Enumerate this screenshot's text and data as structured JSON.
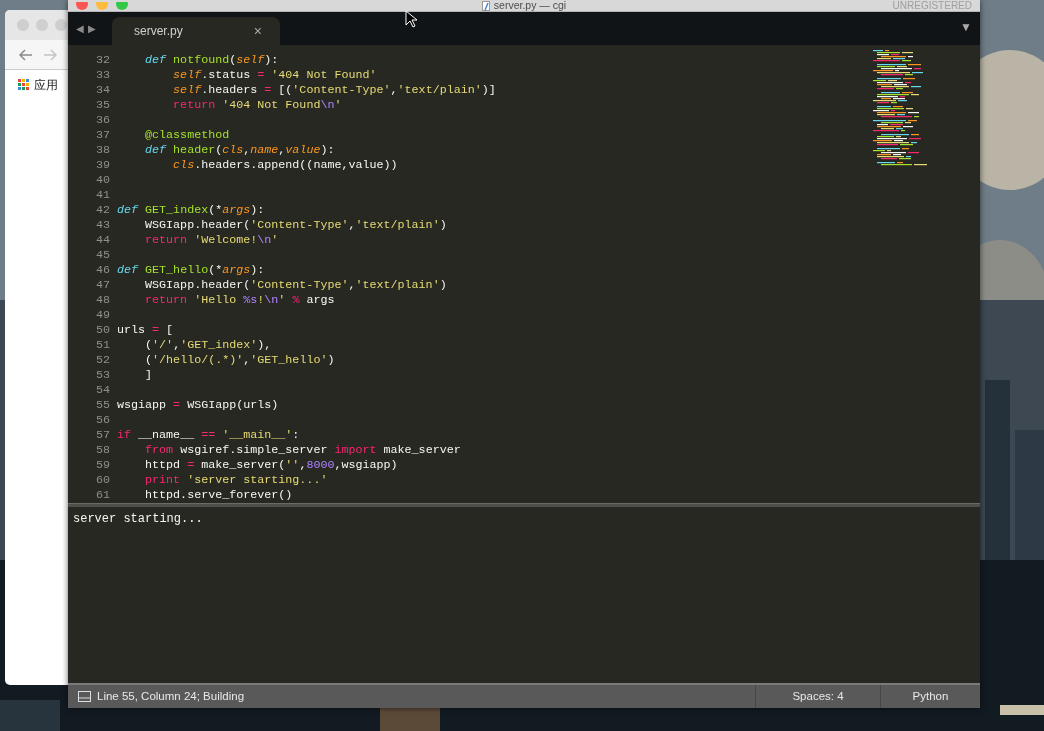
{
  "browser_window": {
    "bookmark_label": "应用"
  },
  "editor": {
    "title": "server.py — cgi",
    "license": "UNREGISTERED",
    "tab_nav": [
      "◀",
      "▶"
    ],
    "tabs": [
      {
        "label": "server.py",
        "close": "×",
        "selected": true
      }
    ],
    "tab_menu": "▼",
    "lines": [
      {
        "number": "32",
        "tokens": [
          {
            "text": "    def ",
            "kind": "storage"
          },
          {
            "text": "notfound",
            "kind": "function"
          },
          {
            "text": "(",
            "kind": "plain"
          },
          {
            "text": "self",
            "kind": "param"
          },
          {
            "text": "):",
            "kind": "plain"
          }
        ]
      },
      {
        "number": "33",
        "tokens": [
          {
            "text": "        self",
            "kind": "param"
          },
          {
            "text": ".status ",
            "kind": "plain"
          },
          {
            "text": "= ",
            "kind": "operator"
          },
          {
            "text": "'404 Not Found'",
            "kind": "string"
          }
        ]
      },
      {
        "number": "34",
        "tokens": [
          {
            "text": "        self",
            "kind": "param"
          },
          {
            "text": ".headers ",
            "kind": "plain"
          },
          {
            "text": "=",
            "kind": "operator"
          },
          {
            "text": " [(",
            "kind": "plain"
          },
          {
            "text": "'Content-Type'",
            "kind": "string"
          },
          {
            "text": ",",
            "kind": "plain"
          },
          {
            "text": "'text/plain'",
            "kind": "string"
          },
          {
            "text": ")]",
            "kind": "plain"
          }
        ]
      },
      {
        "number": "35",
        "tokens": [
          {
            "text": "        return ",
            "kind": "keyword"
          },
          {
            "text": "'404 Not Found",
            "kind": "string"
          },
          {
            "text": "\\n",
            "kind": "constant"
          },
          {
            "text": "'",
            "kind": "string"
          }
        ]
      },
      {
        "number": "36"
      },
      {
        "number": "37",
        "tokens": [
          {
            "text": "    @classmethod",
            "kind": "decorator"
          }
        ]
      },
      {
        "number": "38",
        "tokens": [
          {
            "text": "    def ",
            "kind": "storage"
          },
          {
            "text": "header",
            "kind": "function"
          },
          {
            "text": "(",
            "kind": "plain"
          },
          {
            "text": "cls",
            "kind": "param"
          },
          {
            "text": ",",
            "kind": "plain"
          },
          {
            "text": "name",
            "kind": "param"
          },
          {
            "text": ",",
            "kind": "plain"
          },
          {
            "text": "value",
            "kind": "param"
          },
          {
            "text": "):",
            "kind": "plain"
          }
        ]
      },
      {
        "number": "39",
        "tokens": [
          {
            "text": "        cls",
            "kind": "param"
          },
          {
            "text": ".headers.append((name,value))",
            "kind": "plain"
          }
        ]
      },
      {
        "number": "40"
      },
      {
        "number": "41"
      },
      {
        "number": "42",
        "tokens": [
          {
            "text": "def ",
            "kind": "storage"
          },
          {
            "text": "GET_index",
            "kind": "function"
          },
          {
            "text": "(*",
            "kind": "plain"
          },
          {
            "text": "args",
            "kind": "param"
          },
          {
            "text": "):",
            "kind": "plain"
          }
        ]
      },
      {
        "number": "43",
        "tokens": [
          {
            "text": "    WSGIapp.header(",
            "kind": "plain"
          },
          {
            "text": "'Content-Type'",
            "kind": "string"
          },
          {
            "text": ",",
            "kind": "plain"
          },
          {
            "text": "'text/plain'",
            "kind": "string"
          },
          {
            "text": ")",
            "kind": "plain"
          }
        ]
      },
      {
        "number": "44",
        "tokens": [
          {
            "text": "    return ",
            "kind": "keyword"
          },
          {
            "text": "'Welcome!",
            "kind": "string"
          },
          {
            "text": "\\n",
            "kind": "constant"
          },
          {
            "text": "'",
            "kind": "string"
          }
        ]
      },
      {
        "number": "45"
      },
      {
        "number": "46",
        "tokens": [
          {
            "text": "def ",
            "kind": "storage"
          },
          {
            "text": "GET_hello",
            "kind": "function"
          },
          {
            "text": "(*",
            "kind": "plain"
          },
          {
            "text": "args",
            "kind": "param"
          },
          {
            "text": "):",
            "kind": "plain"
          }
        ]
      },
      {
        "number": "47",
        "tokens": [
          {
            "text": "    WSGIapp.header(",
            "kind": "plain"
          },
          {
            "text": "'Content-Type'",
            "kind": "string"
          },
          {
            "text": ",",
            "kind": "plain"
          },
          {
            "text": "'text/plain'",
            "kind": "string"
          },
          {
            "text": ")",
            "kind": "plain"
          }
        ]
      },
      {
        "number": "48",
        "tokens": [
          {
            "text": "    return ",
            "kind": "keyword"
          },
          {
            "text": "'Hello ",
            "kind": "string"
          },
          {
            "text": "%s",
            "kind": "constant"
          },
          {
            "text": "!",
            "kind": "string"
          },
          {
            "text": "\\n",
            "kind": "constant"
          },
          {
            "text": "' ",
            "kind": "string"
          },
          {
            "text": "%",
            "kind": "operator"
          },
          {
            "text": " args",
            "kind": "plain"
          }
        ]
      },
      {
        "number": "49"
      },
      {
        "number": "50",
        "tokens": [
          {
            "text": "urls ",
            "kind": "plain"
          },
          {
            "text": "=",
            "kind": "operator"
          },
          {
            "text": " [",
            "kind": "plain"
          }
        ]
      },
      {
        "number": "51",
        "tokens": [
          {
            "text": "    (",
            "kind": "plain"
          },
          {
            "text": "'/'",
            "kind": "string"
          },
          {
            "text": ",",
            "kind": "plain"
          },
          {
            "text": "'GET_index'",
            "kind": "string"
          },
          {
            "text": "),",
            "kind": "plain"
          }
        ]
      },
      {
        "number": "52",
        "tokens": [
          {
            "text": "    (",
            "kind": "plain"
          },
          {
            "text": "'/hello/(.*)'",
            "kind": "string"
          },
          {
            "text": ",",
            "kind": "plain"
          },
          {
            "text": "'GET_hello'",
            "kind": "string"
          },
          {
            "text": ")",
            "kind": "plain"
          }
        ]
      },
      {
        "number": "53",
        "tokens": [
          {
            "text": "    ]",
            "kind": "plain"
          }
        ]
      },
      {
        "number": "54"
      },
      {
        "number": "55",
        "tokens": [
          {
            "text": "wsgiapp ",
            "kind": "plain"
          },
          {
            "text": "=",
            "kind": "operator"
          },
          {
            "text": " WSGIapp(urls)",
            "kind": "plain"
          }
        ]
      },
      {
        "number": "56"
      },
      {
        "number": "57",
        "tokens": [
          {
            "text": "if",
            "kind": "keyword"
          },
          {
            "text": " __name__ ",
            "kind": "plain"
          },
          {
            "text": "== ",
            "kind": "operator"
          },
          {
            "text": "'__main__'",
            "kind": "string"
          },
          {
            "text": ":",
            "kind": "plain"
          }
        ]
      },
      {
        "number": "58",
        "tokens": [
          {
            "text": "    from ",
            "kind": "keyword"
          },
          {
            "text": "wsgiref.simple_server ",
            "kind": "plain"
          },
          {
            "text": "import ",
            "kind": "keyword"
          },
          {
            "text": "make_server",
            "kind": "plain"
          }
        ]
      },
      {
        "number": "59",
        "tokens": [
          {
            "text": "    httpd ",
            "kind": "plain"
          },
          {
            "text": "=",
            "kind": "operator"
          },
          {
            "text": " make_server(",
            "kind": "plain"
          },
          {
            "text": "''",
            "kind": "string"
          },
          {
            "text": ",",
            "kind": "plain"
          },
          {
            "text": "8000",
            "kind": "constant"
          },
          {
            "text": ",wsgiapp)",
            "kind": "plain"
          }
        ]
      },
      {
        "number": "60",
        "tokens": [
          {
            "text": "    print ",
            "kind": "keyword"
          },
          {
            "text": "'server starting...'",
            "kind": "string"
          }
        ]
      },
      {
        "number": "61",
        "tokens": [
          {
            "text": "    httpd.serve_forever()",
            "kind": "plain"
          }
        ]
      }
    ],
    "output": [
      "server starting..."
    ],
    "status": {
      "message": "Line 55, Column 24; Building",
      "indentation": "Spaces: 4",
      "syntax": "Python"
    }
  }
}
